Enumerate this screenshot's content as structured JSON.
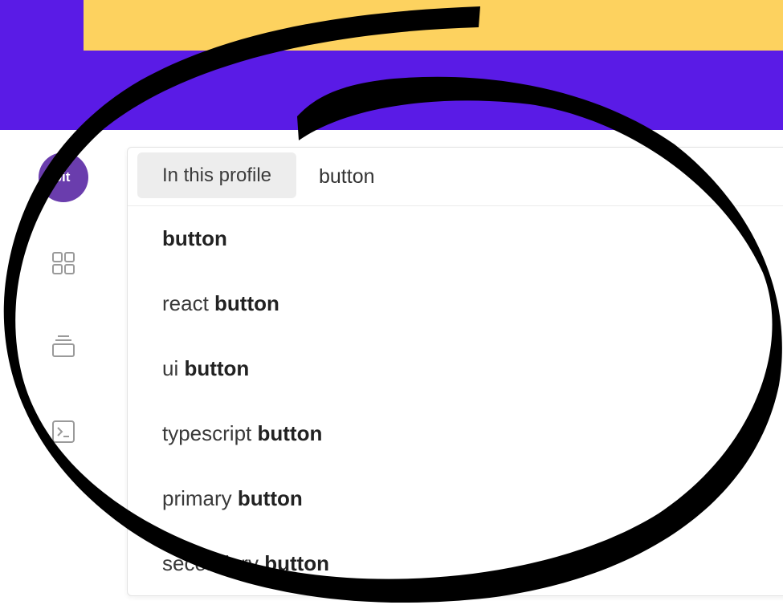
{
  "colors": {
    "banner_primary": "#5a1be6",
    "banner_accent": "#fdd25f",
    "avatar_bg": "#6a3dad",
    "chip_bg": "#ededed",
    "rail_icon": "#9a9a9a"
  },
  "sidebar": {
    "avatar_text": "bit",
    "icons": [
      {
        "name": "grid-icon"
      },
      {
        "name": "stack-icon"
      },
      {
        "name": "terminal-icon"
      }
    ]
  },
  "search": {
    "scope_label": "In this profile",
    "query": "button"
  },
  "suggestions": [
    {
      "prefix": "",
      "match": "button"
    },
    {
      "prefix": "react ",
      "match": "button"
    },
    {
      "prefix": "ui ",
      "match": "button"
    },
    {
      "prefix": "typescript ",
      "match": "button"
    },
    {
      "prefix": "primary ",
      "match": "button"
    },
    {
      "prefix": "secondary ",
      "match": "button"
    }
  ]
}
